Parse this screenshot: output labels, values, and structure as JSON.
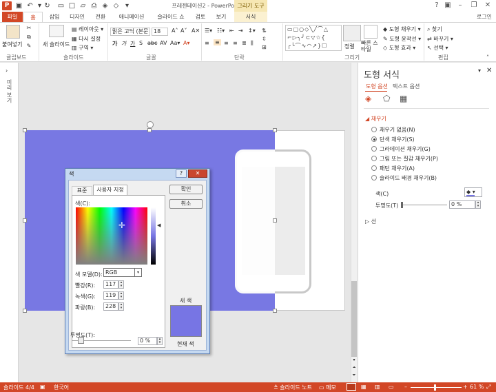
{
  "app": {
    "icon_label": "P",
    "title": "프레젠테이션2 - PowerPoint",
    "context_group": "그리기 도구",
    "user": "로그인"
  },
  "tabs": [
    "파일",
    "홈",
    "삽입",
    "디자인",
    "전환",
    "애니메이션",
    "슬라이드 쇼",
    "검토",
    "보기",
    "서식"
  ],
  "ribbon": {
    "paste_label": "붙여넣기",
    "new_slide_label": "새 슬라이드",
    "layout_label": "레이아웃",
    "reset_label": "다시 설정",
    "section_label": "구역",
    "font_name": "맑은 고딕 (본문",
    "font_size": "18",
    "quick_styles_label": "빠른 스타일",
    "arrange_label": "정렬",
    "shape_fill_label": "도형 채우기",
    "shape_outline_label": "도형 윤곽선",
    "shape_effect_label": "도형 효과",
    "find_label": "찾기",
    "replace_label": "바꾸기",
    "select_label": "선택",
    "groups": [
      "클립보드",
      "슬라이드",
      "글꼴",
      "단락",
      "그리기",
      "편집"
    ]
  },
  "left_panel_label": "미리 보기",
  "format_pane": {
    "title": "도형 서식",
    "tab_shape": "도형 옵션",
    "tab_text": "텍스트 옵션",
    "fill_section": "채우기",
    "fill_options": [
      "채우기 없음(N)",
      "단색 채우기(S)",
      "그라데이션 채우기(G)",
      "그림 또는 질감 채우기(P)",
      "패턴 채우기(A)",
      "슬라이드 배경 채우기(B)"
    ],
    "fill_selected_index": 1,
    "color_label": "색(C)",
    "transparency_label": "투명도(T)",
    "transparency_value": "0 %",
    "line_section": "선",
    "accent_color": "#7775e4"
  },
  "dialog": {
    "title": "색",
    "tab_standard": "표준",
    "tab_custom": "사용자 지정",
    "colors_label": "색(C):",
    "color_model_label": "색 모델(D):",
    "color_model_value": "RGB",
    "red_label": "빨강(R):",
    "red_value": "117",
    "green_label": "녹색(G):",
    "green_value": "119",
    "blue_label": "파랑(B):",
    "blue_value": "228",
    "transparency_label": "투명도(T):",
    "transparency_value": "0 %",
    "ok_label": "확인",
    "cancel_label": "취소",
    "new_label": "새 색",
    "current_label": "현재 색",
    "help_label": "?",
    "close_label": "✕"
  },
  "status": {
    "slide_info": "슬라이드 4/4",
    "language": "한국어",
    "notes_label": "슬라이드 노트",
    "comments_label": "메모",
    "zoom": "61 %"
  }
}
